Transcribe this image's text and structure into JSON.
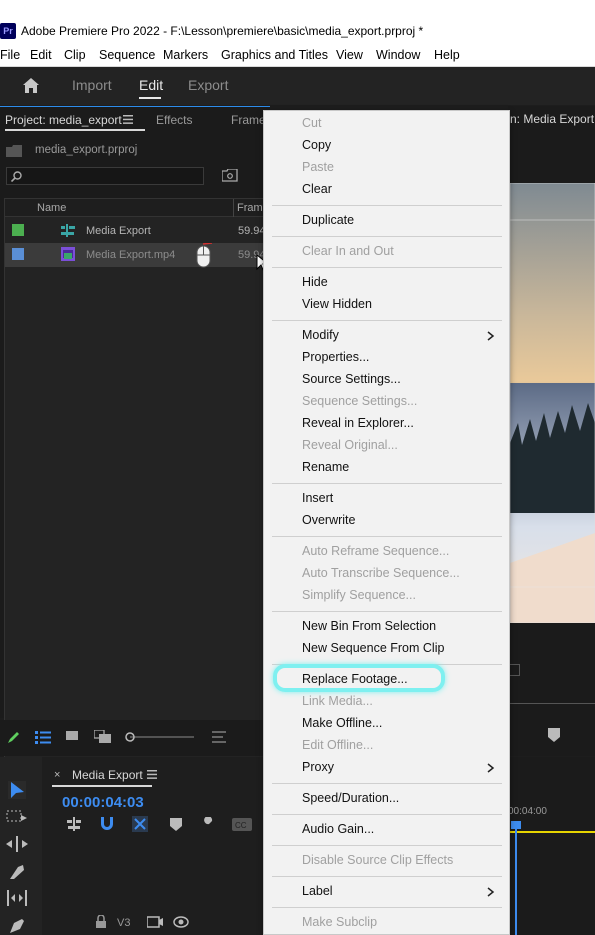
{
  "window": {
    "app_icon": "Pr",
    "title": "Adobe Premiere Pro 2022 - F:\\Lesson\\premiere\\basic\\media_export.prproj *"
  },
  "menubar": [
    "File",
    "Edit",
    "Clip",
    "Sequence",
    "Markers",
    "Graphics and Titles",
    "View",
    "Window",
    "Help"
  ],
  "workspace": {
    "tabs": [
      "Import",
      "Edit",
      "Export"
    ],
    "active": "Edit"
  },
  "project_panel": {
    "tabs": [
      "Project: media_export",
      "Effects",
      "Frame"
    ],
    "project_file": "media_export.prproj",
    "search_placeholder": "",
    "columns": {
      "name": "Name",
      "frame_rate": "Fram"
    },
    "rows": [
      {
        "name": "Media Export",
        "fps": "59.94",
        "color": "#4caf50",
        "icon": "sequence-icon"
      },
      {
        "name": "Media Export.mp4",
        "fps": "59.94",
        "color": "#5a8fd6",
        "icon": "video-clip-icon"
      }
    ]
  },
  "program_monitor": {
    "title": "n: Media Export"
  },
  "timeline": {
    "sequence_name": "Media Export",
    "timecode": "00:00:04:03",
    "ruler_time": "00:04:00",
    "track_label": "V3"
  },
  "context_menu": {
    "items": [
      {
        "label": "Cut",
        "enabled": false
      },
      {
        "label": "Copy",
        "enabled": true
      },
      {
        "label": "Paste",
        "enabled": false
      },
      {
        "label": "Clear",
        "enabled": true
      },
      {
        "sep": true
      },
      {
        "label": "Duplicate",
        "enabled": true
      },
      {
        "sep": true
      },
      {
        "label": "Clear In and Out",
        "enabled": false
      },
      {
        "sep": true
      },
      {
        "label": "Hide",
        "enabled": true
      },
      {
        "label": "View Hidden",
        "enabled": true
      },
      {
        "sep": true
      },
      {
        "label": "Modify",
        "enabled": true,
        "submenu": true
      },
      {
        "label": "Properties...",
        "enabled": true
      },
      {
        "label": "Source Settings...",
        "enabled": true
      },
      {
        "label": "Sequence Settings...",
        "enabled": false
      },
      {
        "label": "Reveal in Explorer...",
        "enabled": true
      },
      {
        "label": "Reveal Original...",
        "enabled": false
      },
      {
        "label": "Rename",
        "enabled": true
      },
      {
        "sep": true
      },
      {
        "label": "Insert",
        "enabled": true
      },
      {
        "label": "Overwrite",
        "enabled": true
      },
      {
        "sep": true
      },
      {
        "label": "Auto Reframe Sequence...",
        "enabled": false
      },
      {
        "label": "Auto Transcribe Sequence...",
        "enabled": false
      },
      {
        "label": "Simplify Sequence...",
        "enabled": false
      },
      {
        "sep": true
      },
      {
        "label": "New Bin From Selection",
        "enabled": true
      },
      {
        "label": "New Sequence From Clip",
        "enabled": true
      },
      {
        "sep": true
      },
      {
        "label": "Replace Footage...",
        "enabled": true,
        "highlighted": true
      },
      {
        "label": "Link Media...",
        "enabled": false
      },
      {
        "label": "Make Offline...",
        "enabled": true
      },
      {
        "label": "Edit Offline...",
        "enabled": false
      },
      {
        "label": "Proxy",
        "enabled": true,
        "submenu": true
      },
      {
        "sep": true
      },
      {
        "label": "Speed/Duration...",
        "enabled": true
      },
      {
        "sep": true
      },
      {
        "label": "Audio Gain...",
        "enabled": true
      },
      {
        "sep": true
      },
      {
        "label": "Disable Source Clip Effects",
        "enabled": false
      },
      {
        "sep": true
      },
      {
        "label": "Label",
        "enabled": true,
        "submenu": true
      },
      {
        "sep": true
      },
      {
        "label": "Make Subclip",
        "enabled": false
      }
    ]
  }
}
